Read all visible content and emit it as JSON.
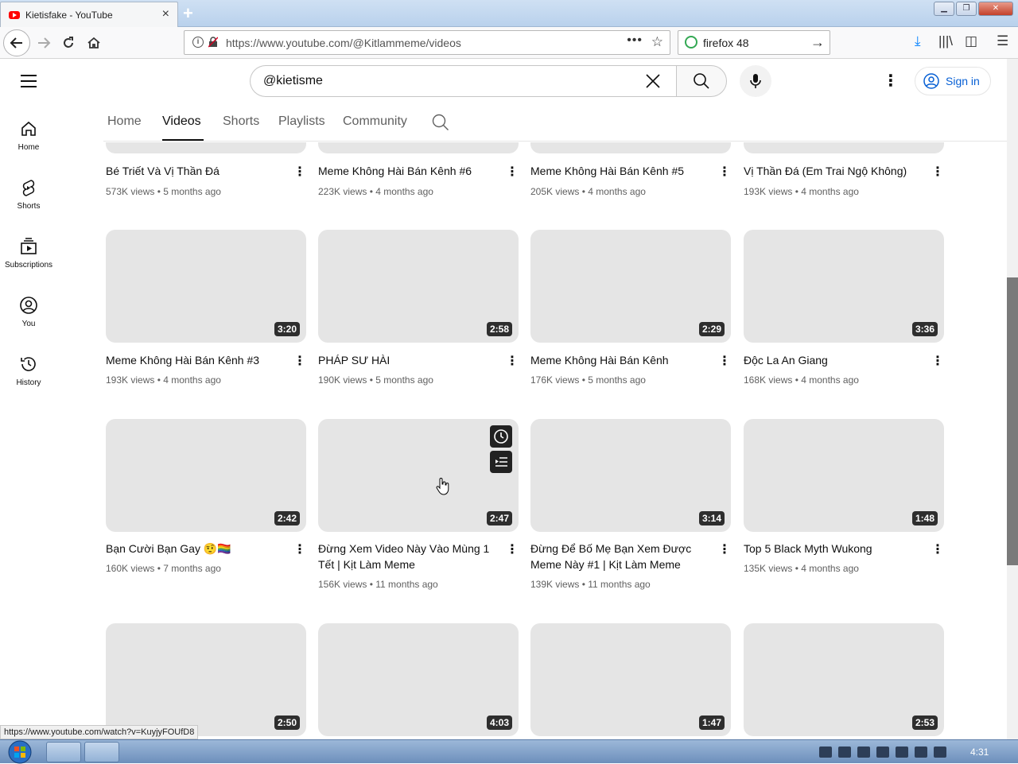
{
  "browser": {
    "tab_title": "Kietisfake - YouTube",
    "url": "https://www.youtube.com/@Kitlammeme/videos",
    "search_engine_text": "firefox 48",
    "status_url": "https://www.youtube.com/watch?v=KuyjyFOUfD8"
  },
  "header": {
    "search_value": "@kietisme",
    "signin_label": "Sign in"
  },
  "sidebar": {
    "items": [
      {
        "label": "Home",
        "icon": "home-icon"
      },
      {
        "label": "Shorts",
        "icon": "shorts-icon"
      },
      {
        "label": "Subscriptions",
        "icon": "subscriptions-icon"
      },
      {
        "label": "You",
        "icon": "you-icon"
      },
      {
        "label": "History",
        "icon": "history-icon"
      }
    ]
  },
  "channel_tabs": [
    {
      "label": "Home"
    },
    {
      "label": "Videos"
    },
    {
      "label": "Shorts"
    },
    {
      "label": "Playlists"
    },
    {
      "label": "Community"
    }
  ],
  "videos": [
    {
      "title": "Bé Triết Và Vị Thần Đá",
      "meta": "573K views • 5 months ago"
    },
    {
      "title": "Meme Không Hài Bán Kênh #6",
      "meta": "223K views • 4 months ago"
    },
    {
      "title": "Meme Không Hài Bán Kênh #5",
      "meta": "205K views • 4 months ago"
    },
    {
      "title": "Vị Thần Đá (Em Trai Ngộ Không)",
      "meta": "193K views • 4 months ago"
    },
    {
      "title": "Meme Không Hài Bán Kênh #3",
      "meta": "193K views • 4 months ago",
      "duration": "3:20"
    },
    {
      "title": "PHÁP SƯ HÀI",
      "meta": "190K views • 5 months ago",
      "duration": "2:58"
    },
    {
      "title": "Meme Không Hài Bán Kênh",
      "meta": "176K views • 5 months ago",
      "duration": "2:29"
    },
    {
      "title": "Độc La An Giang",
      "meta": "168K views • 4 months ago",
      "duration": "3:36"
    },
    {
      "title": "Bạn Cười Bạn Gay 🤨🏳️‍🌈",
      "meta": "160K views • 7 months ago",
      "duration": "2:42"
    },
    {
      "title": "Đừng Xem Video Này Vào Mùng 1 Tết | Kịt Làm Meme",
      "meta": "156K views • 11 months ago",
      "duration": "2:47"
    },
    {
      "title": "Đừng Để Bố Mẹ Bạn Xem Được Meme Này #1 | Kịt Làm Meme",
      "meta": "139K views • 11 months ago",
      "duration": "3:14"
    },
    {
      "title": "Top 5 Black Myth Wukong",
      "meta": "135K views • 4 months ago",
      "duration": "1:48"
    },
    {
      "duration": "2:50"
    },
    {
      "duration": "4:03"
    },
    {
      "duration": "1:47"
    },
    {
      "duration": "2:53"
    }
  ],
  "taskbar": {
    "clock": "4:31"
  }
}
